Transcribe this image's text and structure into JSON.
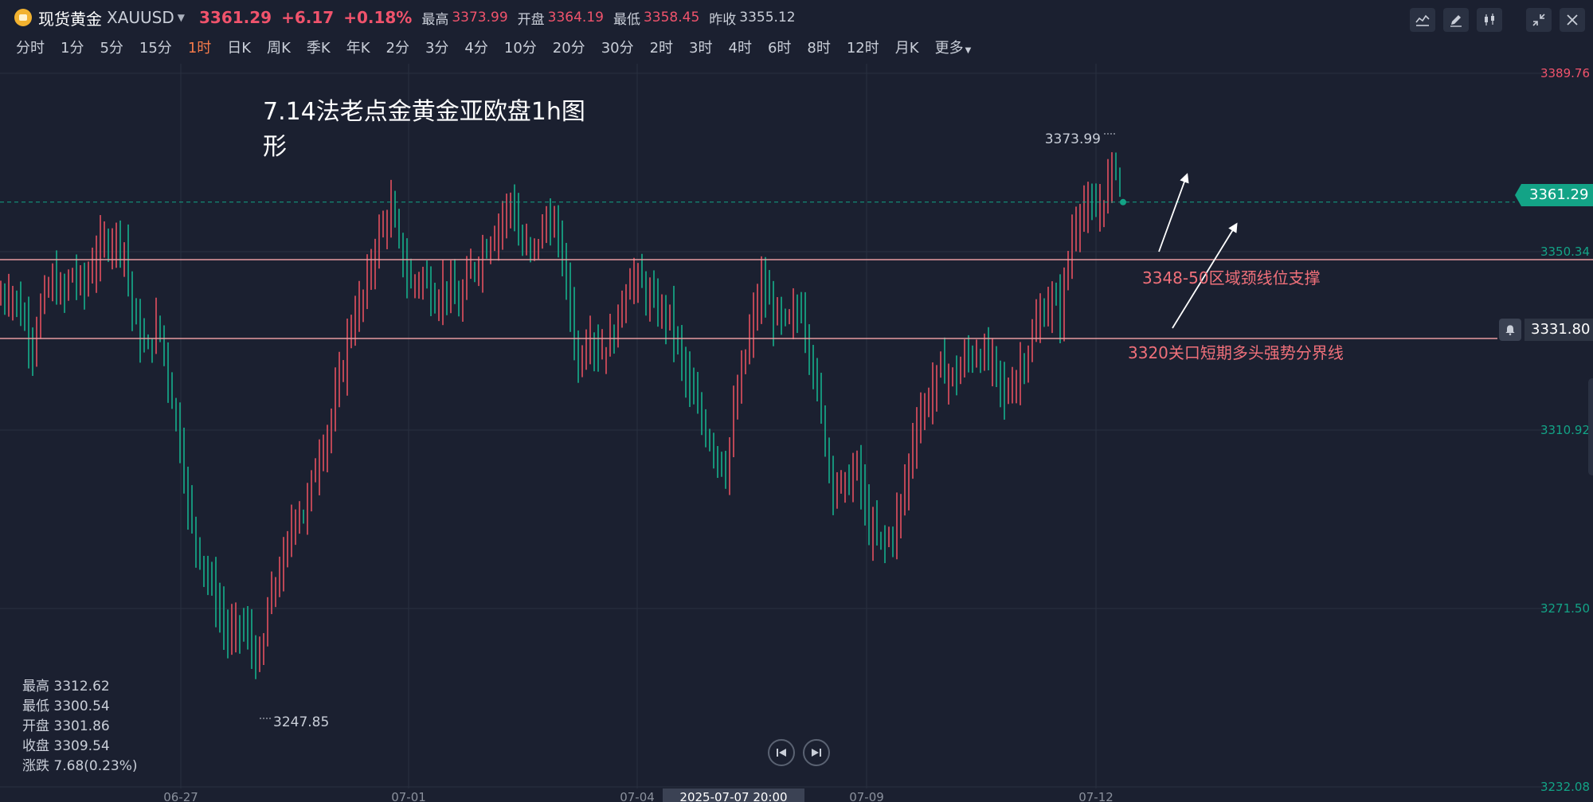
{
  "header": {
    "name": "现货黄金",
    "code": "XAUUSD",
    "price": "3361.29",
    "change": "+6.17",
    "change_pct": "+0.18%",
    "high_label": "最高",
    "high": "3373.99",
    "open_label": "开盘",
    "open": "3364.19",
    "low_label": "最低",
    "low": "3358.45",
    "prev_label": "昨收",
    "prev": "3355.12"
  },
  "tools": [
    "indicator-icon",
    "draw-icon",
    "candle-type-icon",
    "shrink-icon",
    "close-icon"
  ],
  "periods": [
    "分时",
    "1分",
    "5分",
    "15分",
    "1时",
    "日K",
    "周K",
    "季K",
    "年K",
    "2分",
    "3分",
    "4分",
    "10分",
    "20分",
    "30分",
    "2时",
    "3时",
    "4时",
    "6时",
    "8时",
    "12时",
    "月K",
    "更多"
  ],
  "active_period": "1时",
  "ohlc_panel": {
    "high": "最高 3312.62",
    "low": "最低 3300.54",
    "open": "开盘 3301.86",
    "close": "收盘 3309.54",
    "change": "涨跌 7.68(0.23%)"
  },
  "chart_data": {
    "type": "candlestick",
    "title_line1": "7.14法老点金黄金亚欧盘1h图",
    "title_line2": "形",
    "y_ticks": [
      {
        "value": 3389.76,
        "label": "3389.76",
        "color": "#f0536c"
      },
      {
        "value": 3350.34,
        "label": "3350.34",
        "color": "#13a386"
      },
      {
        "value": 3310.92,
        "label": "3310.92",
        "color": "#13a386"
      },
      {
        "value": 3271.5,
        "label": "3271.50",
        "color": "#13a386"
      },
      {
        "value": 3232.08,
        "label": "3232.08",
        "color": "#13a386"
      }
    ],
    "x_ticks": [
      "06-27",
      "07-01",
      "07-04",
      "07-09",
      "07-12"
    ],
    "crosshair_date": "2025-07-07 20:00",
    "current_price": "3361.29",
    "alert_price": "3331.80",
    "max_label": "3373.99",
    "min_label": "3247.85",
    "hlines": [
      3349,
      3331.8
    ],
    "annotations": {
      "support": "3348-50区域颈线位支撑",
      "boundary": "3320关口短期多头强势分界线"
    },
    "path_points": [
      [
        0,
        3340
      ],
      [
        10,
        3342
      ],
      [
        20,
        3337
      ],
      [
        32,
        3330
      ],
      [
        40,
        3338
      ],
      [
        52,
        3344
      ],
      [
        62,
        3340
      ],
      [
        70,
        3346
      ],
      [
        82,
        3342
      ],
      [
        95,
        3350
      ],
      [
        112,
        3354
      ],
      [
        122,
        3352
      ],
      [
        132,
        3335
      ],
      [
        145,
        3328
      ],
      [
        156,
        3335
      ],
      [
        168,
        3320
      ],
      [
        180,
        3305
      ],
      [
        186,
        3292
      ],
      [
        195,
        3285
      ],
      [
        210,
        3275
      ],
      [
        225,
        3265
      ],
      [
        238,
        3268
      ],
      [
        250,
        3262
      ],
      [
        258,
        3258
      ],
      [
        262,
        3270
      ],
      [
        270,
        3276
      ],
      [
        280,
        3282
      ],
      [
        292,
        3294
      ],
      [
        300,
        3292
      ],
      [
        312,
        3304
      ],
      [
        325,
        3312
      ],
      [
        335,
        3322
      ],
      [
        345,
        3334
      ],
      [
        358,
        3340
      ],
      [
        370,
        3352
      ],
      [
        385,
        3360
      ],
      [
        395,
        3350
      ],
      [
        405,
        3343
      ],
      [
        416,
        3345
      ],
      [
        428,
        3340
      ],
      [
        440,
        3343
      ],
      [
        452,
        3338
      ],
      [
        462,
        3345
      ],
      [
        475,
        3350
      ],
      [
        490,
        3356
      ],
      [
        505,
        3362
      ],
      [
        512,
        3352
      ],
      [
        525,
        3350
      ],
      [
        540,
        3358
      ],
      [
        552,
        3352
      ],
      [
        562,
        3338
      ],
      [
        570,
        3325
      ],
      [
        580,
        3333
      ],
      [
        592,
        3328
      ],
      [
        605,
        3332
      ],
      [
        620,
        3345
      ],
      [
        632,
        3343
      ],
      [
        645,
        3338
      ],
      [
        660,
        3336
      ],
      [
        672,
        3326
      ],
      [
        682,
        3318
      ],
      [
        695,
        3311
      ],
      [
        706,
        3306
      ],
      [
        715,
        3302
      ],
      [
        726,
        3318
      ],
      [
        738,
        3331
      ],
      [
        750,
        3343
      ],
      [
        762,
        3337
      ],
      [
        775,
        3334
      ],
      [
        790,
        3338
      ],
      [
        802,
        3324
      ],
      [
        812,
        3310
      ],
      [
        820,
        3300
      ],
      [
        832,
        3298
      ],
      [
        845,
        3303
      ],
      [
        855,
        3290
      ],
      [
        866,
        3286
      ],
      [
        878,
        3287
      ],
      [
        890,
        3296
      ],
      [
        902,
        3312
      ],
      [
        915,
        3318
      ],
      [
        928,
        3325
      ],
      [
        940,
        3322
      ],
      [
        952,
        3327
      ],
      [
        965,
        3328
      ],
      [
        978,
        3326
      ],
      [
        990,
        3318
      ],
      [
        1000,
        3322
      ],
      [
        1012,
        3328
      ],
      [
        1022,
        3334
      ],
      [
        1035,
        3340
      ],
      [
        1045,
        3337
      ],
      [
        1055,
        3352
      ],
      [
        1065,
        3361
      ],
      [
        1075,
        3358
      ],
      [
        1085,
        3360
      ],
      [
        1095,
        3368
      ],
      [
        1101,
        3370
      ],
      [
        1106,
        3361
      ]
    ]
  }
}
